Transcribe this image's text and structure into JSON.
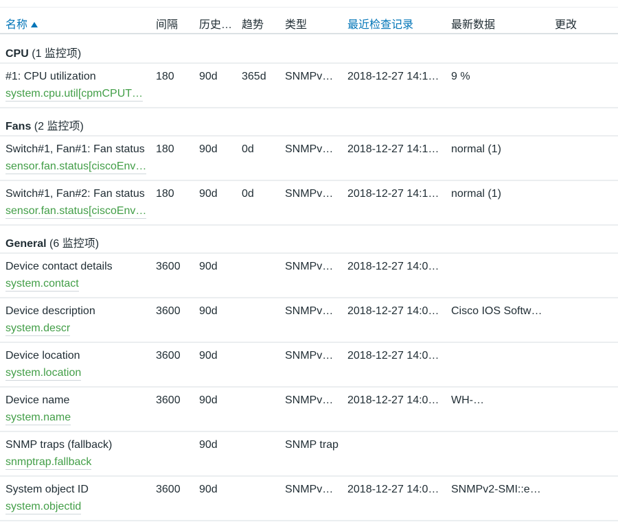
{
  "header": {
    "name": "名称",
    "interval": "间隔",
    "history": "历史…",
    "trends": "趋势",
    "type": "类型",
    "last_check": "最近检查记录",
    "latest_data": "最新数据",
    "change": "更改"
  },
  "groups": [
    {
      "name": "CPU",
      "count": "(1 监控项)",
      "items": [
        {
          "name": "#1: CPU utilization",
          "key": "system.cpu.util[cpmCPUT…",
          "interval": "180",
          "history": "90d",
          "trends": "365d",
          "type": "SNMPv…",
          "last_check": "2018-12-27 14:1…",
          "latest_data": "9 %",
          "change": ""
        }
      ]
    },
    {
      "name": "Fans",
      "count": "(2 监控项)",
      "items": [
        {
          "name": "Switch#1, Fan#1: Fan status",
          "key": "sensor.fan.status[ciscoEnv…",
          "interval": "180",
          "history": "90d",
          "trends": "0d",
          "type": "SNMPv…",
          "last_check": "2018-12-27 14:1…",
          "latest_data": "normal (1)",
          "change": ""
        },
        {
          "name": "Switch#1, Fan#2: Fan status",
          "key": "sensor.fan.status[ciscoEnv…",
          "interval": "180",
          "history": "90d",
          "trends": "0d",
          "type": "SNMPv…",
          "last_check": "2018-12-27 14:1…",
          "latest_data": "normal (1)",
          "change": ""
        }
      ]
    },
    {
      "name": "General",
      "count": "(6 监控项)",
      "items": [
        {
          "name": "Device contact details",
          "key": "system.contact",
          "interval": "3600",
          "history": "90d",
          "trends": "",
          "type": "SNMPv…",
          "last_check": "2018-12-27 14:0…",
          "latest_data": "",
          "change": ""
        },
        {
          "name": "Device description",
          "key": "system.descr",
          "interval": "3600",
          "history": "90d",
          "trends": "",
          "type": "SNMPv…",
          "last_check": "2018-12-27 14:0…",
          "latest_data": "Cisco IOS Softw…",
          "change": ""
        },
        {
          "name": "Device location",
          "key": "system.location",
          "interval": "3600",
          "history": "90d",
          "trends": "",
          "type": "SNMPv…",
          "last_check": "2018-12-27 14:0…",
          "latest_data": "",
          "change": ""
        },
        {
          "name": "Device name",
          "key": "system.name",
          "interval": "3600",
          "history": "90d",
          "trends": "",
          "type": "SNMPv…",
          "last_check": "2018-12-27 14:0…",
          "latest_data": "WH-…",
          "change": ""
        },
        {
          "name": "SNMP traps (fallback)",
          "key": "snmptrap.fallback",
          "interval": "",
          "history": "90d",
          "trends": "",
          "type": "SNMP trap",
          "last_check": "",
          "latest_data": "",
          "change": ""
        },
        {
          "name": "System object ID",
          "key": "system.objectid",
          "interval": "3600",
          "history": "90d",
          "trends": "",
          "type": "SNMPv…",
          "last_check": "2018-12-27 14:0…",
          "latest_data": "SNMPv2-SMI::e…",
          "change": ""
        }
      ]
    }
  ]
}
